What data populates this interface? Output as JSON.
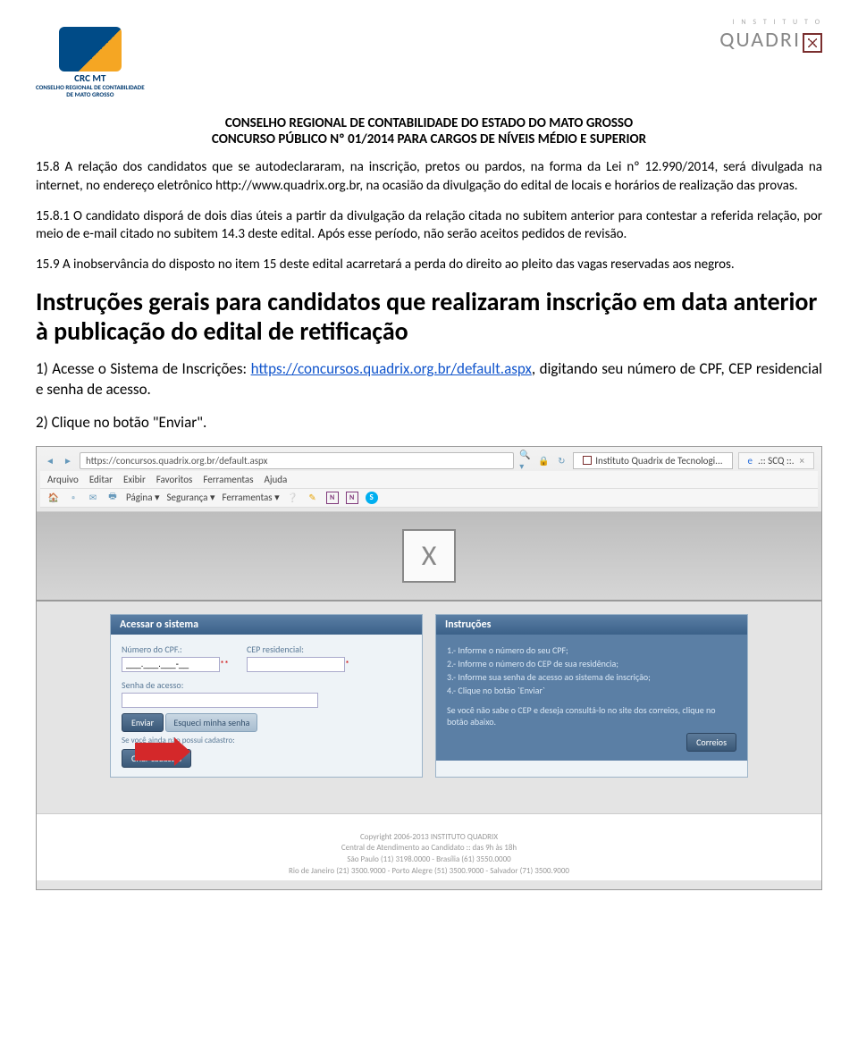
{
  "header": {
    "logo_left_line1": "CRC MT",
    "logo_left_line2": "CONSELHO REGIONAL DE CONTABILIDADE",
    "logo_left_line3": "DE MATO GROSSO",
    "logo_right_inst": "I N S T I T U T O",
    "logo_right_text": "QUADRI"
  },
  "title": {
    "line1": "CONSELHO REGIONAL DE CONTABILIDADE DO ESTADO DO MATO GROSSO",
    "line2": "CONCURSO PÚBLICO Nº 01/2014 PARA CARGOS DE NÍVEIS MÉDIO E SUPERIOR"
  },
  "paragraphs": {
    "p1": "15.8 A relação dos candidatos que se autodeclararam, na inscrição, pretos ou pardos, na forma da Lei nº 12.990/2014, será divulgada na internet, no endereço eletrônico http://www.quadrix.org.br, na ocasião da divulgação do edital de locais e horários de realização das provas.",
    "p2": "15.8.1 O candidato disporá de dois dias úteis a partir da divulgação da relação citada no subitem anterior para contestar a referida relação, por meio de e-mail citado no subitem 14.3 deste edital. Após esse período, não serão aceitos pedidos de revisão.",
    "p3": "15.9 A inobservância do disposto no item 15 deste edital acarretará a perda do direito ao pleito das vagas reservadas aos negros."
  },
  "section_heading": "Instruções gerais para candidatos que realizaram inscrição em data anterior à publicação do edital de retificação",
  "steps": {
    "s1_pre": "1) Acesse o Sistema de Inscrições: ",
    "s1_link": "https://concursos.quadrix.org.br/default.aspx",
    "s1_post": ", digitando seu número de CPF, CEP residencial e senha de acesso.",
    "s2": "2) Clique no botão \"Enviar\"."
  },
  "screenshot": {
    "address_bar": "https://concursos.quadrix.org.br/default.aspx",
    "search_placeholder": "",
    "tab1": "Instituto Quadrix de Tecnologi...",
    "tab2": ".:: SCQ ::.",
    "menu": [
      "Arquivo",
      "Editar",
      "Exibir",
      "Favoritos",
      "Ferramentas",
      "Ajuda"
    ],
    "toolbar": [
      "Página ▾",
      "Segurança ▾",
      "Ferramentas ▾"
    ],
    "panel_login": {
      "title": "Acessar o sistema",
      "cpf_label": "Número do CPF.:",
      "cpf_value": "___.___.___-__",
      "cpf_suffix": "**",
      "cep_label": "CEP residencial:",
      "cep_value": "",
      "cep_suffix": "*",
      "senha_label": "Senha de acesso:",
      "btn_enviar": "Enviar",
      "btn_esqueci": "Esqueci minha senha",
      "sub1": "Se você ainda não possui cadastro:",
      "btn_criar": "Criar cadastro"
    },
    "panel_instr": {
      "title": "Instruções",
      "items": [
        "1.- Informe o número do seu CPF;",
        "2.- Informe o número do CEP de sua residência;",
        "3.- Informe sua senha de acesso ao sistema de inscrição;",
        "4.- Clique no botão `Enviar`"
      ],
      "note": "Se você não sabe o CEP e deseja consultá-lo no site dos correios, clique no botão abaixo.",
      "btn_correios": "Correios"
    },
    "footer": {
      "l1": "Copyright 2006-2013 INSTITUTO QUADRIX",
      "l2": "Central de Atendimento ao Candidato :: das 9h às 18h",
      "l3": "São Paulo (11) 3198.0000 - Brasília (61) 3550.0000",
      "l4": "Rio de Janeiro (21) 3500.9000 - Porto Alegre (51) 3500.9000 - Salvador (71) 3500.9000"
    }
  }
}
